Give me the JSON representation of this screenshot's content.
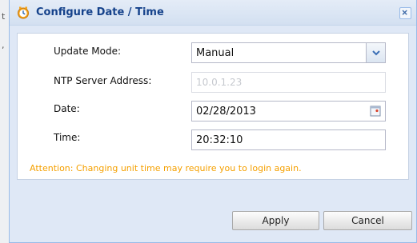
{
  "dialog": {
    "title": "Configure Date / Time"
  },
  "form": {
    "update_mode": {
      "label": "Update Mode:",
      "value": "Manual"
    },
    "ntp_server": {
      "label": "NTP Server Address:",
      "value": "10.0.1.23"
    },
    "date": {
      "label": "Date:",
      "value": "02/28/2013"
    },
    "time": {
      "label": "Time:",
      "value": "20:32:10"
    }
  },
  "attention": "Attention: Changing unit time may require you to login again.",
  "buttons": {
    "apply": "Apply",
    "cancel": "Cancel"
  },
  "colors": {
    "title": "#15428b",
    "attention": "#f5a000",
    "dialog_bg": "#dfe8f6",
    "border": "#99bbe8"
  },
  "icons": {
    "title": "clock-icon",
    "close": "close-icon",
    "combo": "chevron-down-icon",
    "date": "calendar-icon"
  }
}
